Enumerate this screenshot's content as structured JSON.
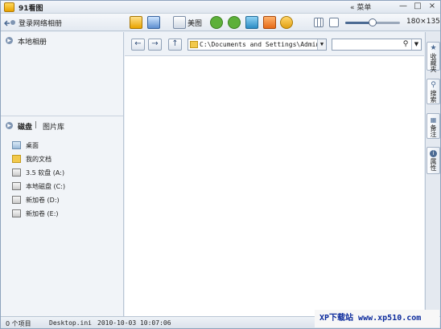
{
  "app": {
    "title": "91看图"
  },
  "titlebar": {
    "menu_label": "« 菜单",
    "minimize": "—",
    "maximize": "□",
    "close": "×"
  },
  "toolbar": {
    "login_label": "登录网络相册",
    "beautify_label": "美图",
    "zoom_text": "180×135",
    "zoom_level": 0.5,
    "icons": [
      "slideshow-icon",
      "wallpaper-icon",
      "beautify-icon",
      "rotate-left-icon",
      "rotate-right-icon",
      "delete-icon",
      "send-icon",
      "chat-icon",
      "view-mode-icon",
      "thumbnail-size-icon"
    ]
  },
  "left": {
    "local_album": "本地相册",
    "tabs": {
      "disk": "磁盘",
      "separator": "|",
      "library": "图片库"
    },
    "tree": [
      {
        "label": "桌面",
        "icon": "desktop-icon"
      },
      {
        "label": "我的文档",
        "icon": "my-documents-icon"
      },
      {
        "label": "3.5 软盘 (A:)",
        "icon": "floppy-drive-icon"
      },
      {
        "label": "本地磁盘 (C:)",
        "icon": "disk-drive-icon"
      },
      {
        "label": "新加卷 (D:)",
        "icon": "disk-drive-icon"
      },
      {
        "label": "新加卷 (E:)",
        "icon": "disk-drive-icon"
      }
    ]
  },
  "address": {
    "path": "C:\\Documents and Settings\\Admin",
    "search_value": ""
  },
  "right_tabs": [
    {
      "label": "收藏夹",
      "icon": "star-icon"
    },
    {
      "label": "搜索",
      "icon": "search-icon"
    },
    {
      "label": "备注",
      "icon": "notes-icon"
    },
    {
      "label": "属性",
      "icon": "info-icon"
    }
  ],
  "status": {
    "items": "0 个项目",
    "file": "Desktop.ini",
    "date": "2010-10-03 10:07:06"
  },
  "watermark": "XP下载站 www.xp510.com",
  "colors": {
    "accent": "#4b6a93",
    "panel_bg": "#f1f4f8",
    "border": "#b9c5d4"
  }
}
